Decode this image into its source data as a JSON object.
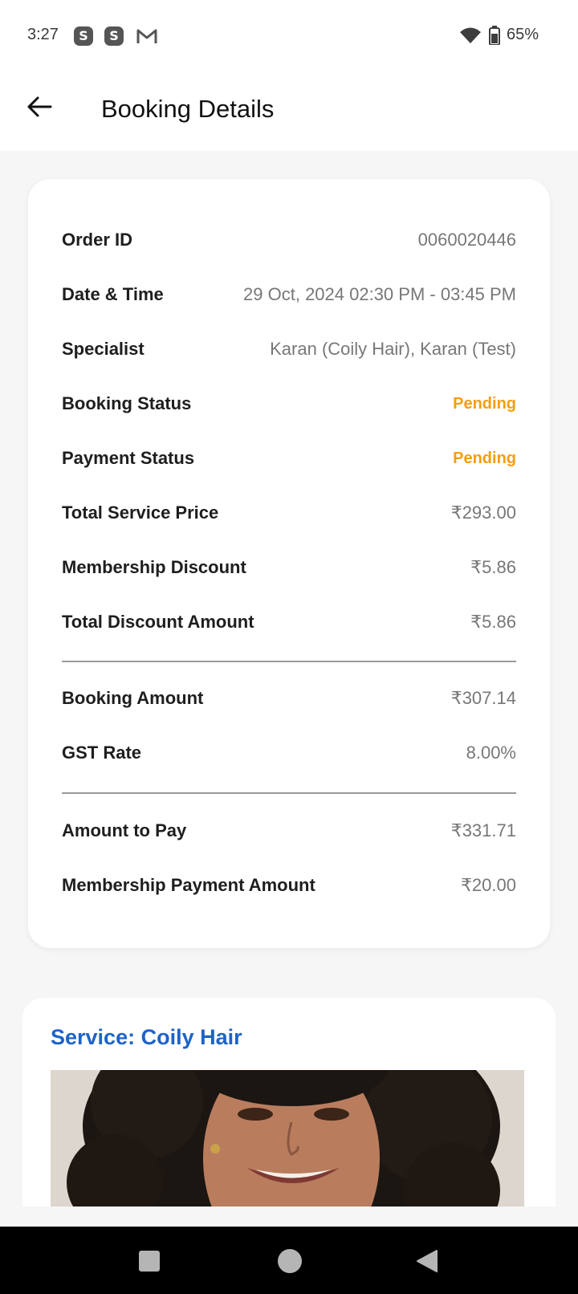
{
  "status_bar": {
    "time": "3:27",
    "notif_icons": [
      "skype-icon",
      "skype-icon",
      "gmail-icon"
    ],
    "battery": "65%"
  },
  "app_bar": {
    "title": "Booking Details"
  },
  "details": [
    {
      "label": "Order ID",
      "value": "0060020446"
    },
    {
      "label": "Date & Time",
      "value": "29 Oct, 2024 02:30 PM - 03:45 PM"
    },
    {
      "label": "Specialist",
      "value": "Karan (Coily Hair), Karan (Test)"
    },
    {
      "label": "Booking Status",
      "value": "Pending"
    },
    {
      "label": "Payment Status",
      "value": "Pending"
    },
    {
      "label": "Total Service Price",
      "value": "₹293.00"
    },
    {
      "label": "Membership Discount",
      "value": "₹5.86"
    },
    {
      "label": "Total Discount Amount",
      "value": "₹5.86"
    },
    {
      "label": "Booking Amount",
      "value": "₹307.14"
    },
    {
      "label": "GST Rate",
      "value": "8.00%"
    },
    {
      "label": "Amount to Pay",
      "value": "₹331.71"
    },
    {
      "label": "Membership Payment Amount",
      "value": "₹20.00"
    }
  ],
  "service": {
    "title": "Service: Coily Hair"
  },
  "colors": {
    "pending": "#f59d12",
    "service_title": "#1d63c9"
  }
}
